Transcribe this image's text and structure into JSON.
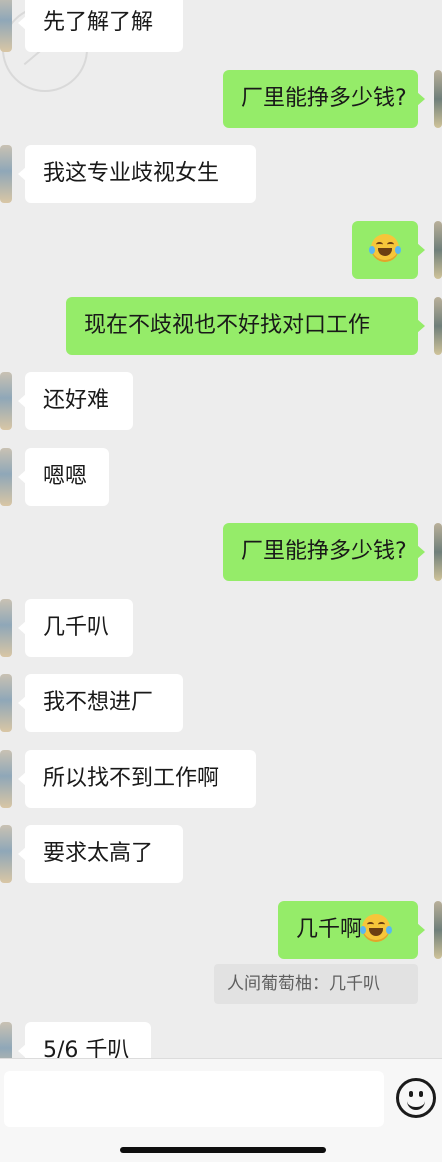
{
  "messages": [
    {
      "side": "left",
      "text": "先了解了解"
    },
    {
      "side": "right",
      "text": "厂里能挣多少钱?"
    },
    {
      "side": "left",
      "text": "我这专业歧视女生"
    },
    {
      "side": "right",
      "emoji": "laughing-tears"
    },
    {
      "side": "right",
      "text": "现在不歧视也不好找对口工作"
    },
    {
      "side": "left",
      "text": "还好难"
    },
    {
      "side": "left",
      "text": "嗯嗯"
    },
    {
      "side": "right",
      "text": "厂里能挣多少钱?"
    },
    {
      "side": "left",
      "text": "几千叭"
    },
    {
      "side": "left",
      "text": "我不想进厂"
    },
    {
      "side": "left",
      "text": "所以找不到工作啊"
    },
    {
      "side": "left",
      "text": "要求太高了"
    },
    {
      "side": "right",
      "text": "几千啊",
      "emoji": "laughing-tears"
    },
    {
      "side": "left",
      "text": "5/6 千叭"
    }
  ],
  "quote": {
    "text": "人间葡萄柚：几千叭"
  },
  "input": {
    "placeholder": ""
  },
  "icons": {
    "emoji_button": "smiley-icon",
    "inline_emoji": "laughing-tears-emoji"
  },
  "colors": {
    "background": "#ededed",
    "incoming_bubble": "#ffffff",
    "outgoing_bubble": "#95ec69",
    "quote_bg": "#e2e2e2"
  }
}
